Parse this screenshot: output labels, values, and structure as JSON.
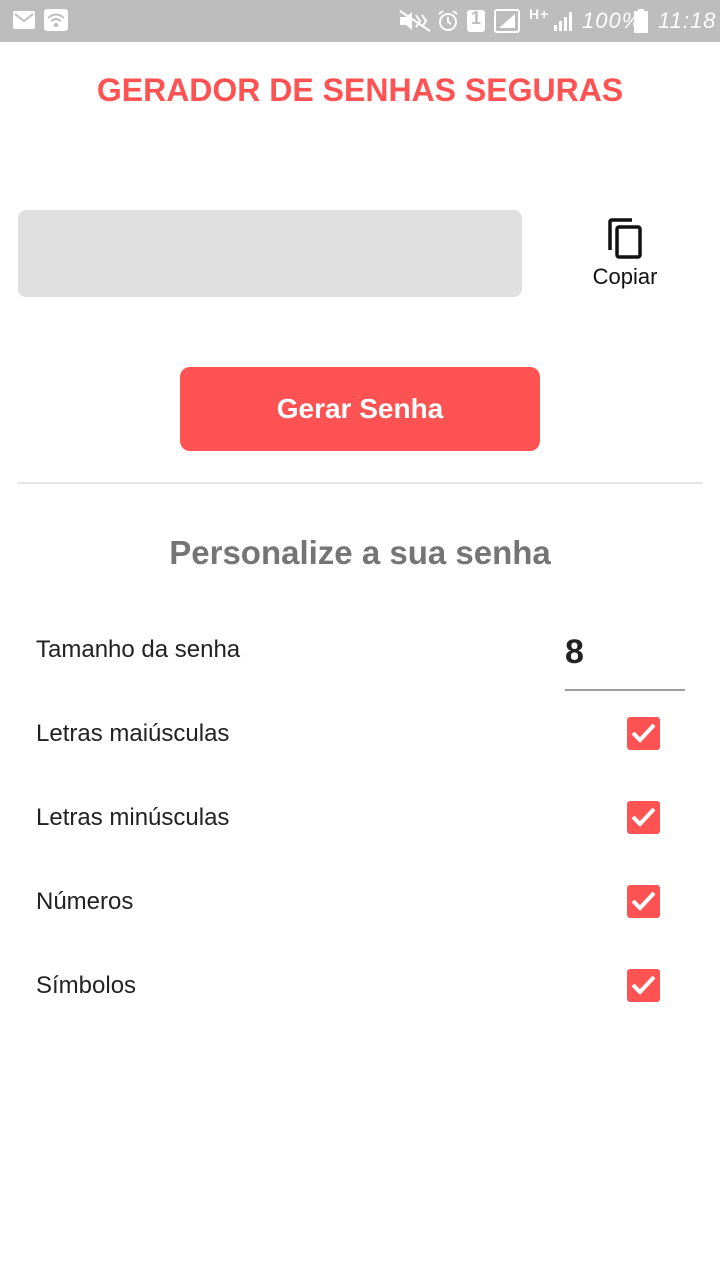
{
  "status_bar": {
    "battery_percent": "100%",
    "time": "11:18",
    "network_type": "H+",
    "sim_badge": "1",
    "icons": [
      "mail-icon",
      "wifi-icon",
      "vibrate-icon",
      "alarm-icon",
      "sim-icon",
      "signal-icon",
      "signal-icon",
      "battery-icon"
    ]
  },
  "app": {
    "title": "GERADOR DE SENHAS SEGURAS",
    "password_value": "",
    "copy_label": "Copiar",
    "generate_label": "Gerar Senha"
  },
  "options": {
    "section_title": "Personalize a sua senha",
    "length_label": "Tamanho da senha",
    "length_value": "8",
    "items": [
      {
        "label": "Letras maiúsculas",
        "checked": true
      },
      {
        "label": "Letras minúsculas",
        "checked": true
      },
      {
        "label": "Números",
        "checked": true
      },
      {
        "label": "Símbolos",
        "checked": true
      }
    ]
  },
  "colors": {
    "accent": "#ff5252",
    "status_bar": "#bdbdbd",
    "field_bg": "#e0e0e0",
    "section_title": "#757575"
  }
}
